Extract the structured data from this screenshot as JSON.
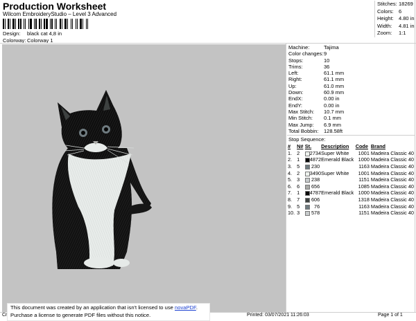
{
  "header": {
    "title": "Production Worksheet",
    "software": "Wilcom EmbroideryStudio – Level 3 Advanced",
    "barcode_bars": [
      2,
      1,
      1,
      2,
      1,
      1,
      3,
      1,
      1,
      2,
      2,
      1,
      1,
      1,
      2,
      1,
      3,
      1,
      1,
      2,
      1,
      2,
      1,
      1,
      2,
      3,
      1,
      1,
      2,
      1,
      1,
      1,
      2,
      2,
      1,
      1,
      3,
      1,
      2,
      1,
      1,
      2,
      1,
      1,
      1,
      3,
      1,
      2,
      1,
      1,
      2
    ],
    "design_label": "Design:",
    "design_value": "black cat 4,8 in",
    "colorway_label": "Colorway:",
    "colorway_value": "Colorway 1"
  },
  "summary": [
    {
      "label": "Stitches:",
      "value": "18269"
    },
    {
      "label": "Colors:",
      "value": "6"
    },
    {
      "label": "Height:",
      "value": "4.80 in"
    },
    {
      "label": "Width:",
      "value": "4.81 in"
    },
    {
      "label": "Zoom:",
      "value": "1:1"
    }
  ],
  "properties": [
    {
      "label": "Machine:",
      "value": "Tajima"
    },
    {
      "label": "Color changes:",
      "value": "9"
    },
    {
      "label": "Stops:",
      "value": "10"
    },
    {
      "label": "Trims:",
      "value": "36"
    },
    {
      "label": "Left:",
      "value": "61.1 mm"
    },
    {
      "label": "Right:",
      "value": "61.1 mm"
    },
    {
      "label": "Up:",
      "value": "61.0 mm"
    },
    {
      "label": "Down:",
      "value": "60.9 mm"
    },
    {
      "label": "EndX:",
      "value": "0.00 in"
    },
    {
      "label": "EndY:",
      "value": "0.00 in"
    },
    {
      "label": "Max Stitch:",
      "value": "10.7 mm"
    },
    {
      "label": "Min Stitch:",
      "value": "0.1 mm"
    },
    {
      "label": "Max Jump:",
      "value": "6.9 mm"
    },
    {
      "label": "Total Bobbin:",
      "value": "128.58ft"
    }
  ],
  "stop_sequence": {
    "title": "Stop Sequence:",
    "columns": [
      "#",
      "N#",
      "St.",
      "Description",
      "Code",
      "Brand"
    ],
    "rows": [
      {
        "n": "1.",
        "needle": "2",
        "color": "#eef2ee",
        "st": "2734",
        "desc": "Super White",
        "code": "1001",
        "brand": "Madeira Classic 40"
      },
      {
        "n": "2.",
        "needle": "1",
        "color": "#0a0a0a",
        "st": "4872",
        "desc": "Emerald Black",
        "code": "1000",
        "brand": "Madeira Classic 40"
      },
      {
        "n": "3.",
        "needle": "5",
        "color": "#6f7b80",
        "st": "230",
        "desc": "",
        "code": "1163",
        "brand": "Madeira Classic 40"
      },
      {
        "n": "4.",
        "needle": "2",
        "color": "#eef2ee",
        "st": "3490",
        "desc": "Super White",
        "code": "1001",
        "brand": "Madeira Classic 40"
      },
      {
        "n": "5.",
        "needle": "3",
        "color": "#c7cbcc",
        "st": "238",
        "desc": "",
        "code": "1151",
        "brand": "Madeira Classic 40"
      },
      {
        "n": "6.",
        "needle": "6",
        "color": "#a8a9a6",
        "st": "656",
        "desc": "",
        "code": "1085",
        "brand": "Madeira Classic 40"
      },
      {
        "n": "7.",
        "needle": "1",
        "color": "#0a0a0a",
        "st": "4787",
        "desc": "Emerald Black",
        "code": "1000",
        "brand": "Madeira Classic 40"
      },
      {
        "n": "8.",
        "needle": "7",
        "color": "#3d4140",
        "st": "606",
        "desc": "",
        "code": "1318",
        "brand": "Madeira Classic 40"
      },
      {
        "n": "9.",
        "needle": "5",
        "color": "#6f7b80",
        "st": "76",
        "desc": "",
        "code": "1163",
        "brand": "Madeira Classic 40"
      },
      {
        "n": "10.",
        "needle": "3",
        "color": "#c7cbcc",
        "st": "578",
        "desc": "",
        "code": "1151",
        "brand": "Madeira Classic 40"
      }
    ]
  },
  "footer": {
    "left": "Cr",
    "printed": "Printed: 03/07/2021 11:26:03",
    "page": "Page 1 of 1"
  },
  "notice": {
    "line1_prefix": "This document was created by an application that isn't licensed to use ",
    "link_text": "novaPDF",
    "line1_suffix": ".",
    "line2": "Purchase a license to generate PDF files without this notice."
  }
}
